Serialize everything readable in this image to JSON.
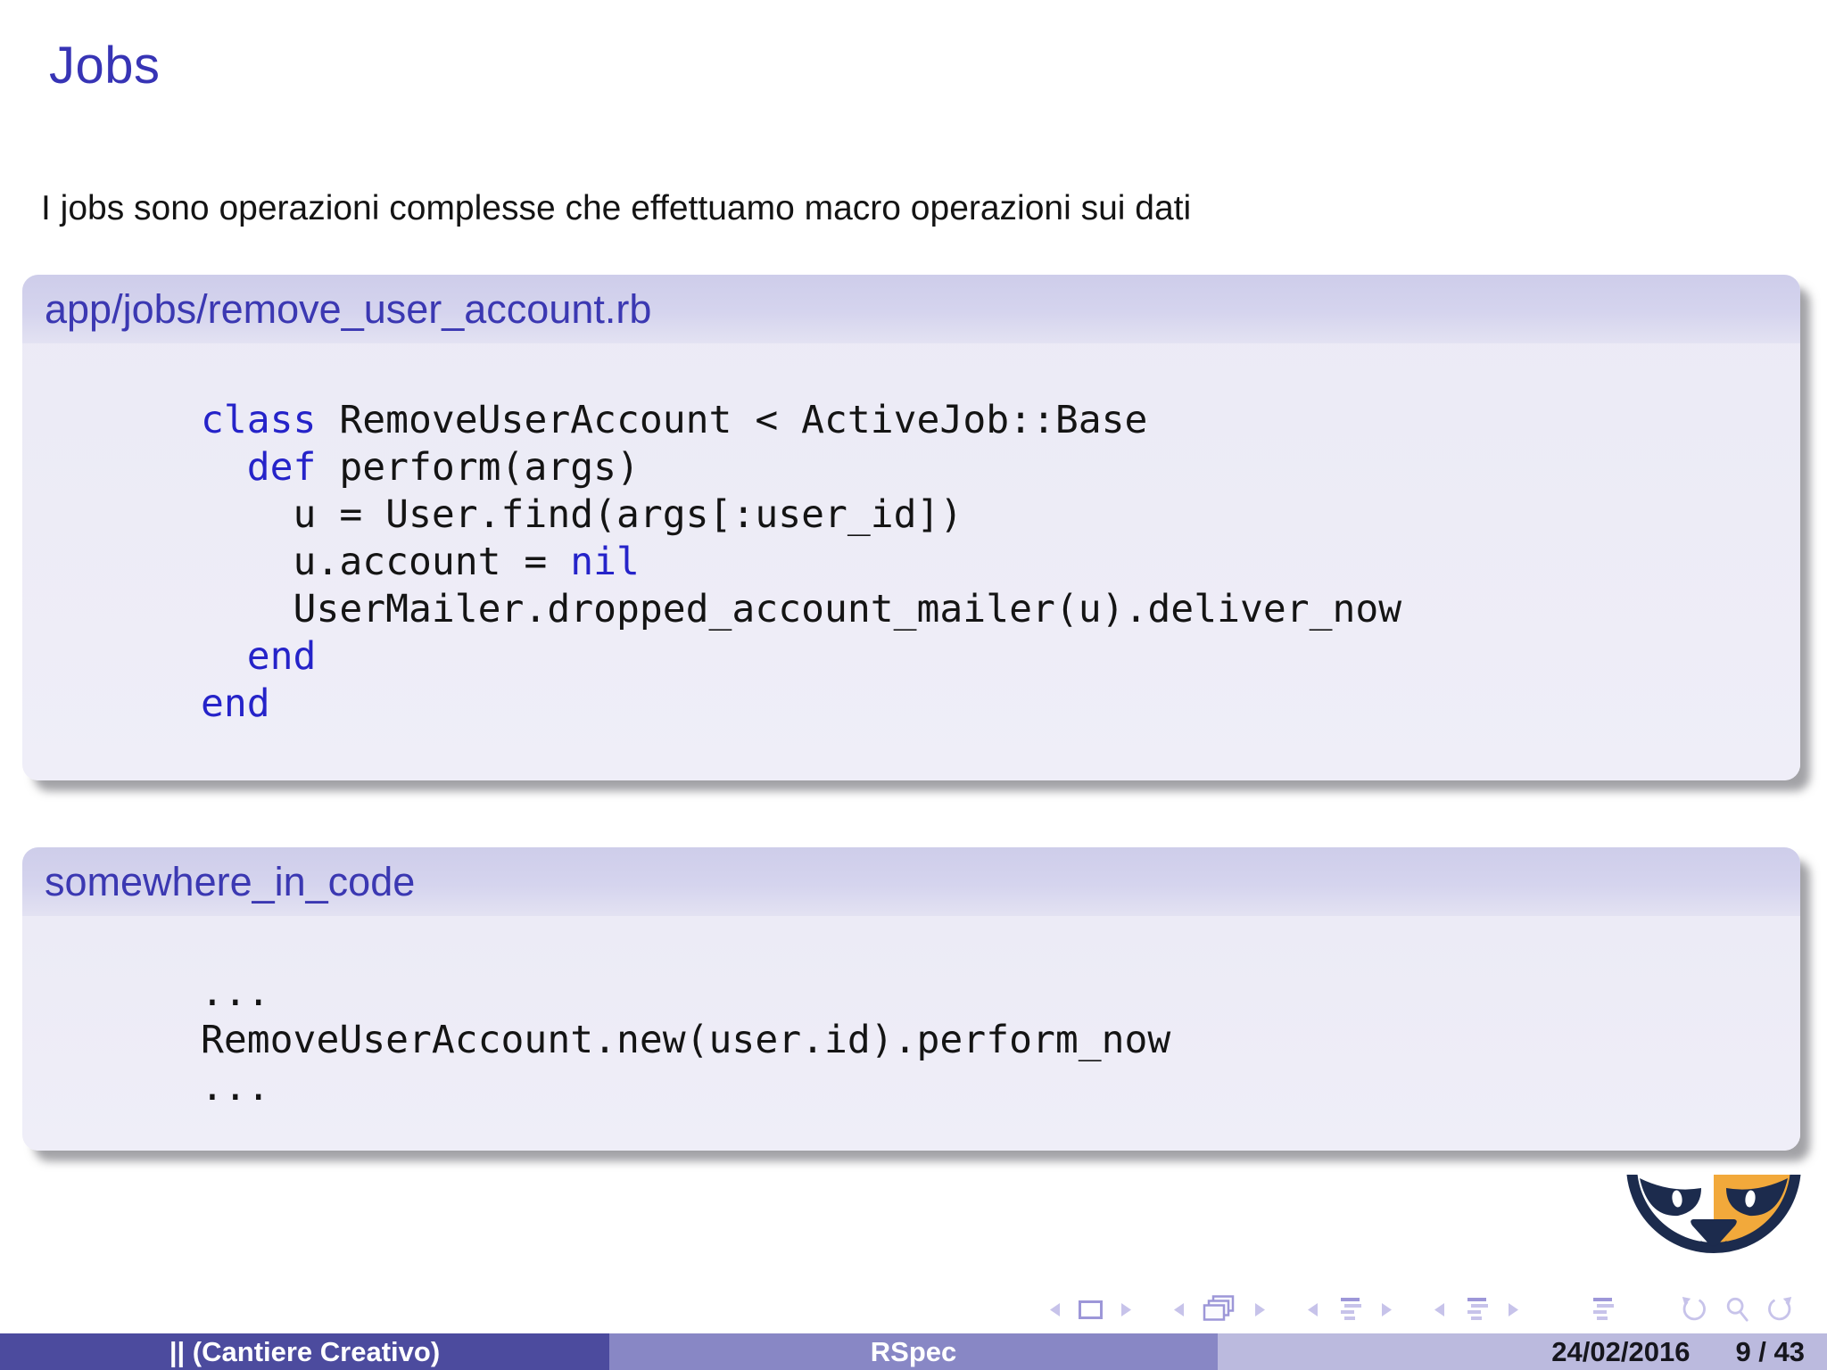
{
  "slide": {
    "title": "Jobs",
    "intro": "I jobs sono operazioni complesse che effettuamo macro operazioni sui dati"
  },
  "blocks": [
    {
      "title": "app/jobs/remove_user_account.rb",
      "code": [
        [
          {
            "s": "class",
            "kw": true
          },
          {
            "s": " RemoveUserAccount < ActiveJob::Base",
            "kw": false
          }
        ],
        [
          {
            "s": "  ",
            "kw": false
          },
          {
            "s": "def",
            "kw": true
          },
          {
            "s": " perform(args)",
            "kw": false
          }
        ],
        [
          {
            "s": "    u = User.find(args[:user_id])",
            "kw": false
          }
        ],
        [
          {
            "s": "    u.account = ",
            "kw": false
          },
          {
            "s": "nil",
            "kw": true
          }
        ],
        [
          {
            "s": "    UserMailer.dropped_account_mailer(u).deliver_now",
            "kw": false
          }
        ],
        [
          {
            "s": "  ",
            "kw": false
          },
          {
            "s": "end",
            "kw": true
          }
        ],
        [
          {
            "s": "end",
            "kw": true
          }
        ]
      ]
    },
    {
      "title": "somewhere_in_code",
      "code": [
        [
          {
            "s": "...",
            "kw": false
          }
        ],
        [
          {
            "s": "RemoveUserAccount.new(user.id).perform_now",
            "kw": false
          }
        ],
        [
          {
            "s": "...",
            "kw": false
          }
        ]
      ]
    }
  ],
  "footer": {
    "author": "|| (Cantiere Creativo)",
    "deck_title": "RSpec",
    "date": "24/02/2016",
    "page": "9 / 43"
  },
  "nav": {
    "icons": [
      "prev-slide-icon",
      "frame-icon",
      "next-slide-icon",
      "prev-frame-icon",
      "frames-stack-icon",
      "next-frame-icon",
      "prev-subsection-icon",
      "subsection-list-icon",
      "next-subsection-icon",
      "prev-section-icon",
      "section-list-icon",
      "next-section-icon",
      "appendix-list-icon",
      "undo-history-icon",
      "search-icon",
      "redo-history-icon"
    ]
  },
  "colors": {
    "title_color": "#3734b5",
    "block_header_text": "#3b38b2",
    "keyword": "#2523c9",
    "footer_left_bg": "#4c4b9e",
    "footer_mid_bg": "#8887c5",
    "footer_right_bg": "#bbbade",
    "nav_icon_light": "#c7c3ea",
    "nav_icon_dark": "#9d97d8",
    "cat_navy": "#1c2b4d",
    "cat_orange": "#f2a93b"
  }
}
